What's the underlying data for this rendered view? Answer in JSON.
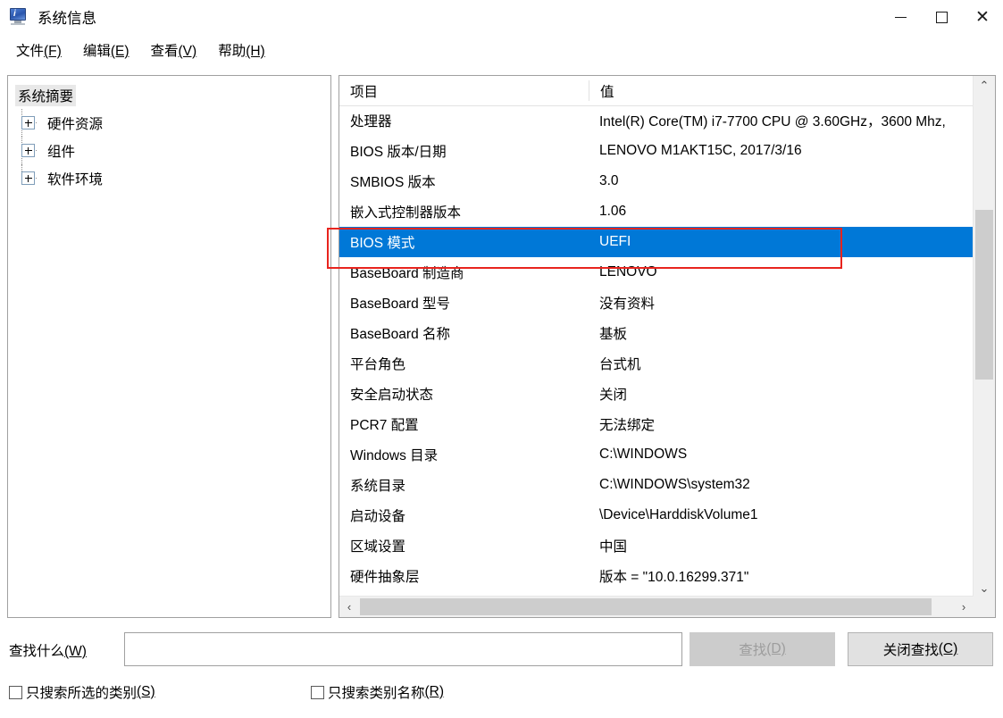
{
  "window": {
    "title": "系统信息",
    "icon": "computer-monitor-icon",
    "controls": {
      "minimize": "–",
      "maximize": "□",
      "close": "✕"
    },
    "accent_color": "#0078d7",
    "annotation_color": "#e8241e"
  },
  "menubar": [
    {
      "label": "文件(F)",
      "text": "文件",
      "accel": "(F)"
    },
    {
      "label": "编辑(E)",
      "text": "编辑",
      "accel": "(E)"
    },
    {
      "label": "查看(V)",
      "text": "查看",
      "accel": "(V)"
    },
    {
      "label": "帮助(H)",
      "text": "帮助",
      "accel": "(H)"
    }
  ],
  "tree": {
    "root": {
      "label": "系统摘要",
      "selected": true
    },
    "items": [
      {
        "label": "硬件资源",
        "expander": "+"
      },
      {
        "label": "组件",
        "expander": "+"
      },
      {
        "label": "软件环境",
        "expander": "+"
      }
    ]
  },
  "list": {
    "columns": [
      "项目",
      "值"
    ],
    "rows": [
      {
        "item": "处理器",
        "value": "Intel(R) Core(TM) i7-7700 CPU @ 3.60GHz，3600 Mhz,",
        "selected": false
      },
      {
        "item": "BIOS 版本/日期",
        "value": "LENOVO M1AKT15C, 2017/3/16",
        "selected": false
      },
      {
        "item": "SMBIOS 版本",
        "value": "3.0",
        "selected": false
      },
      {
        "item": "嵌入式控制器版本",
        "value": "1.06",
        "selected": false
      },
      {
        "item": "BIOS 模式",
        "value": "UEFI",
        "selected": true
      },
      {
        "item": "BaseBoard 制造商",
        "value": "LENOVO",
        "selected": false
      },
      {
        "item": "BaseBoard 型号",
        "value": "没有资料",
        "selected": false
      },
      {
        "item": "BaseBoard 名称",
        "value": "基板",
        "selected": false
      },
      {
        "item": "平台角色",
        "value": "台式机",
        "selected": false
      },
      {
        "item": "安全启动状态",
        "value": "关闭",
        "selected": false
      },
      {
        "item": "PCR7 配置",
        "value": "无法绑定",
        "selected": false
      },
      {
        "item": "Windows 目录",
        "value": "C:\\WINDOWS",
        "selected": false
      },
      {
        "item": "系统目录",
        "value": "C:\\WINDOWS\\system32",
        "selected": false
      },
      {
        "item": "启动设备",
        "value": "\\Device\\HarddiskVolume1",
        "selected": false
      },
      {
        "item": "区域设置",
        "value": "中国",
        "selected": false
      },
      {
        "item": "硬件抽象层",
        "value": "版本 = \"10.0.16299.371\"",
        "selected": false
      }
    ],
    "scroll": {
      "up_arrow": "⌃",
      "down_arrow": "⌄",
      "left_arrow": "‹",
      "right_arrow": "›"
    }
  },
  "findbar": {
    "label": "查找什么(W):",
    "label_text": "查找什么",
    "label_accel": "(W)",
    "input_value": "",
    "input_placeholder": "",
    "find_button": {
      "text": "查找",
      "accel": "(D)",
      "disabled": true
    },
    "close_button": {
      "text": "关闭查找",
      "accel": "(C)",
      "disabled": false
    },
    "checkboxes": [
      {
        "text": "只搜索所选的类别",
        "accel": "(S)",
        "checked": false
      },
      {
        "text": "只搜索类别名称",
        "accel": "(R)",
        "checked": false
      }
    ]
  }
}
